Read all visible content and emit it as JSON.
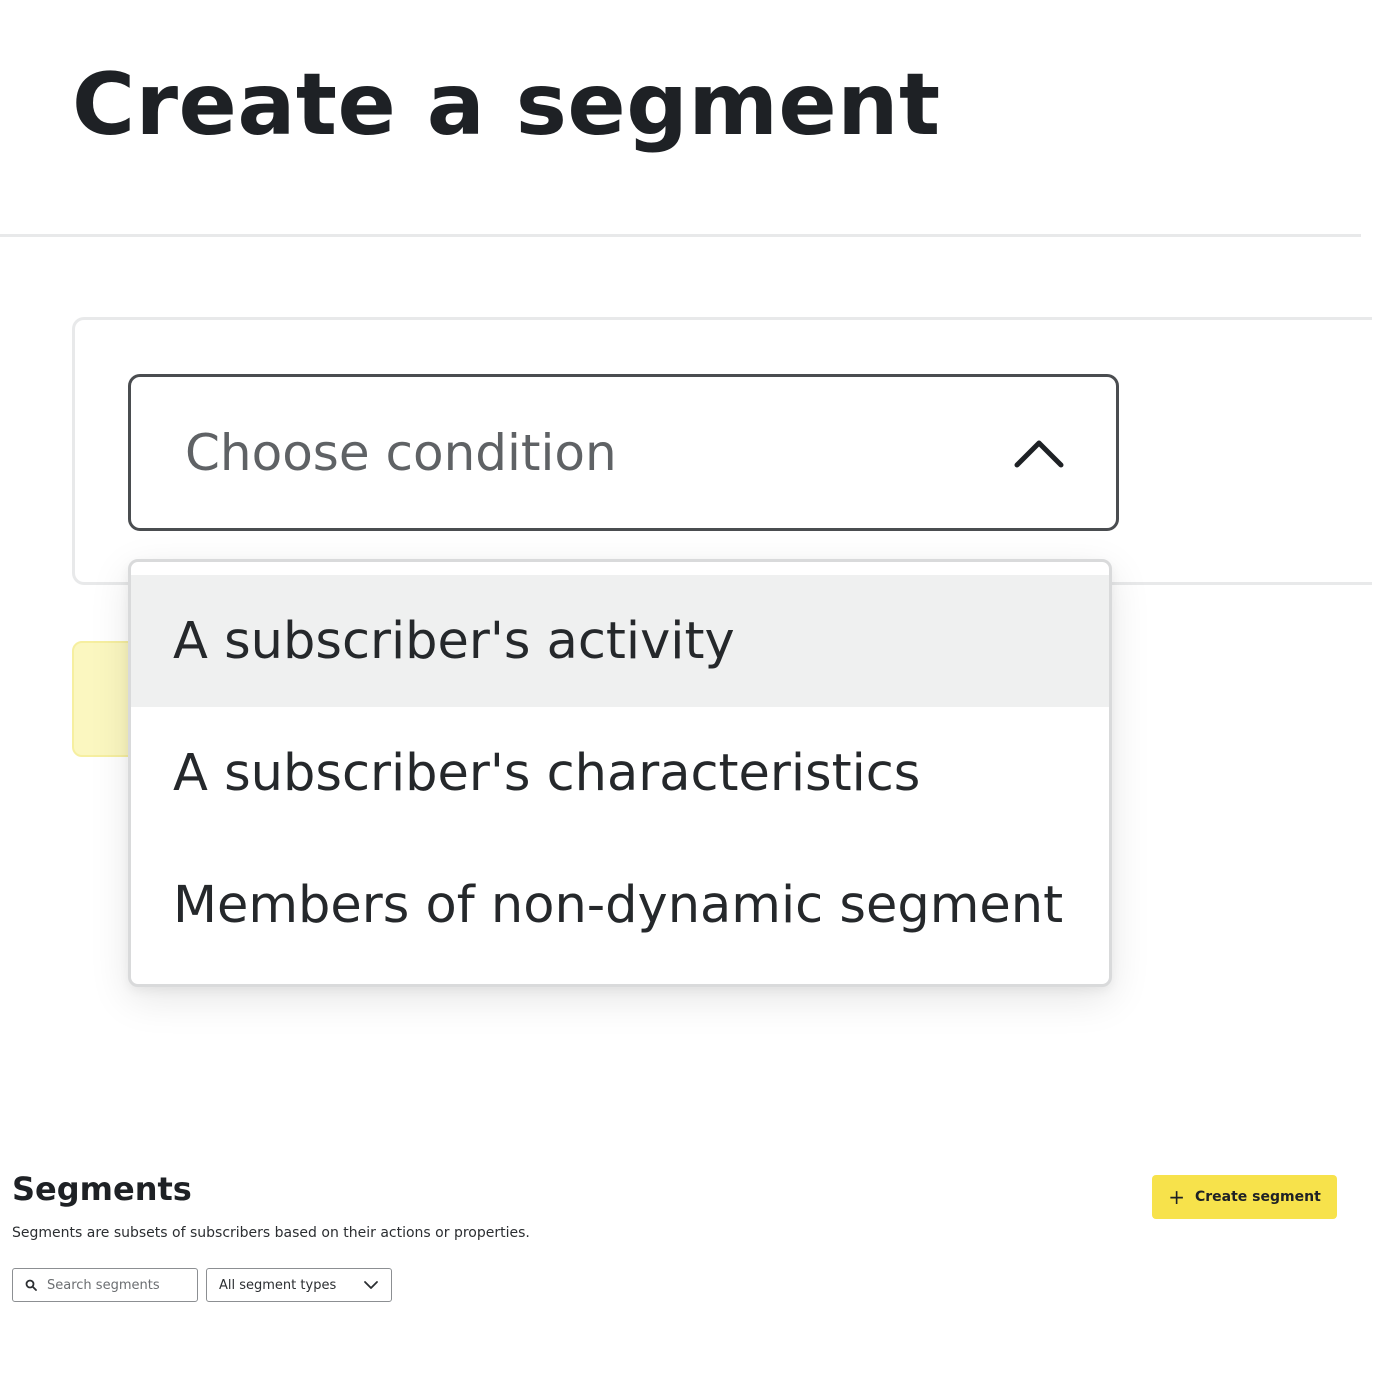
{
  "header": {
    "title": "Create a segment"
  },
  "condition": {
    "select_label": "Choose condition",
    "options": [
      "A subscriber's activity",
      "A subscriber's characteristics",
      "Members of non-dynamic segment"
    ],
    "highlighted_option": "A subscriber's activity"
  },
  "segments": {
    "title": "Segments",
    "description": "Segments are subsets of subscribers based on their actions or properties.",
    "create_button_label": "Create segment",
    "search_placeholder": "Search segments",
    "type_filter_value": "All segment types"
  },
  "icons": {
    "condition_toggle": "chevron-up-icon",
    "create": "plus-icon",
    "search": "search-icon",
    "type_filter": "chevron-down-icon"
  },
  "colors": {
    "accent": "#f7e24b",
    "highlight": "#eff0f0",
    "text": "#1e2125"
  }
}
